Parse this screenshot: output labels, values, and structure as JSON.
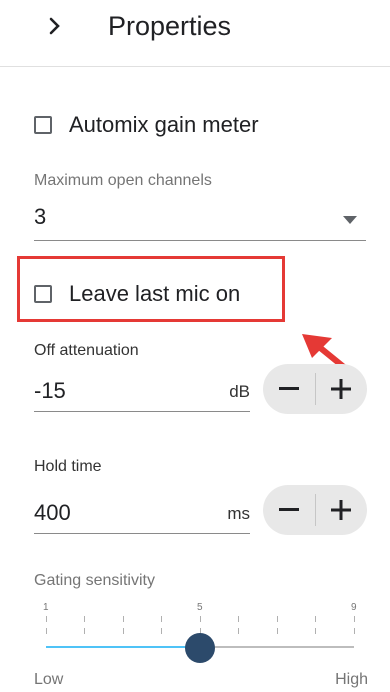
{
  "header": {
    "title": "Properties",
    "chevron_icon": "chevron-right-icon"
  },
  "automix": {
    "label": "Automix gain meter",
    "checked": false
  },
  "max_channels": {
    "label": "Maximum open channels",
    "value": "3",
    "icon": "dropdown-arrow-icon"
  },
  "leave_last_mic": {
    "label": "Leave last mic on",
    "checked": false,
    "highlight_color": "#e53935"
  },
  "off_attenuation": {
    "label": "Off attenuation",
    "value": "-15",
    "unit": "dB",
    "minus": "−",
    "plus": "+"
  },
  "hold_time": {
    "label": "Hold time",
    "value": "400",
    "unit": "ms",
    "minus": "−",
    "plus": "+"
  },
  "gating": {
    "label": "Gating sensitivity",
    "min": 1,
    "max": 9,
    "value": 5,
    "tick_labels": [
      "1",
      "5",
      "9"
    ],
    "low_label": "Low",
    "high_label": "High",
    "accent": "#4fc3f7",
    "thumb_color": "#2c4a6b"
  },
  "annotation": {
    "arrow_color": "#e53935"
  }
}
